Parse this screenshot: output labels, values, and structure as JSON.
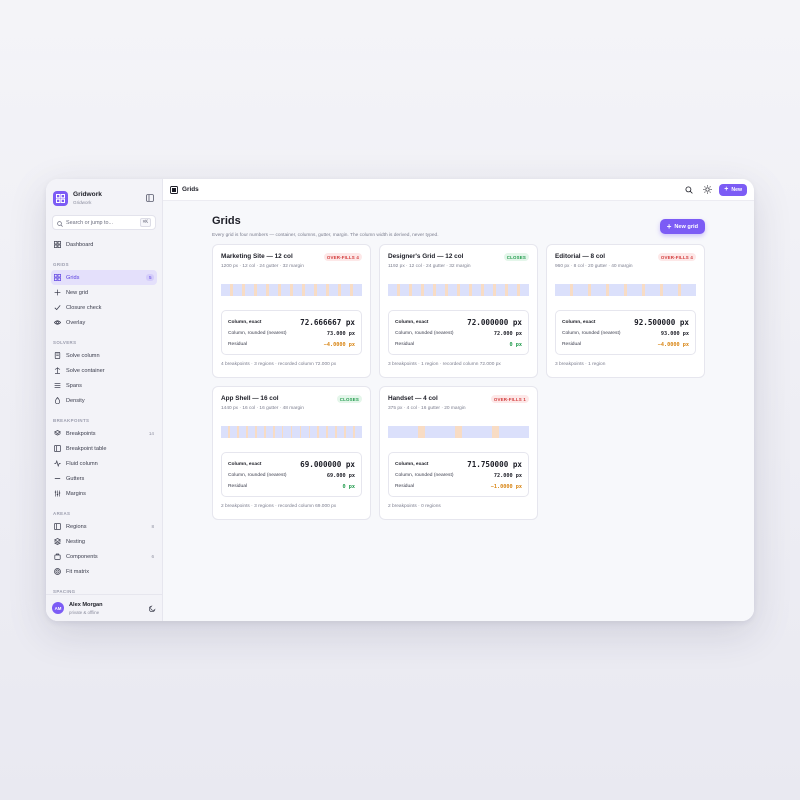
{
  "app": {
    "name": "Gridwork",
    "subtitle": "Gridwork"
  },
  "search": {
    "placeholder": "Search or jump to...",
    "shortcut": "⌘K"
  },
  "nav": {
    "top": [
      {
        "label": "Dashboard",
        "icon": "dashboard-icon"
      }
    ],
    "sections": [
      {
        "title": "GRIDS",
        "items": [
          {
            "label": "Grids",
            "count": "5",
            "active": true
          },
          {
            "label": "New grid"
          },
          {
            "label": "Closure check"
          },
          {
            "label": "Overlay"
          }
        ]
      },
      {
        "title": "SOLVERS",
        "items": [
          {
            "label": "Solve column"
          },
          {
            "label": "Solve container"
          },
          {
            "label": "Spans"
          },
          {
            "label": "Density"
          }
        ]
      },
      {
        "title": "BREAKPOINTS",
        "items": [
          {
            "label": "Breakpoints",
            "count": "14"
          },
          {
            "label": "Breakpoint table"
          },
          {
            "label": "Fluid column"
          },
          {
            "label": "Gutters"
          },
          {
            "label": "Margins"
          }
        ]
      },
      {
        "title": "AREAS",
        "items": [
          {
            "label": "Regions",
            "count": "8"
          },
          {
            "label": "Nesting"
          },
          {
            "label": "Components",
            "count": "6"
          },
          {
            "label": "Fit matrix"
          }
        ]
      },
      {
        "title": "SPACING",
        "items": []
      }
    ]
  },
  "user": {
    "initials": "AM",
    "name": "Alex Morgan",
    "status": "private & offline"
  },
  "topbar": {
    "title": "Grids",
    "new_label": "New"
  },
  "page": {
    "title": "Grids",
    "description": "Every grid is four numbers — container, columns, gutter, margin. The column width is derived, never typed.",
    "new_grid_label": "New grid"
  },
  "labels": {
    "exact": "Column, exact",
    "rounded": "Column, rounded (nearest)",
    "residual": "Residual"
  },
  "colors": {
    "accent": "#7c5cf5",
    "column": "#dbe0fb",
    "gutter": "#f8dcc4"
  },
  "cards": [
    {
      "title": "Marketing Site — 12 col",
      "meta": "1200 px · 12 col · 24 gutter · 32 margin",
      "badge": "OVER-FILLS 4",
      "status": "over",
      "columns": 12,
      "gutter_ratio": 0.33,
      "exact": "72.666667 px",
      "rounded": "73.000 px",
      "residual": "−4.0000 px",
      "residual_kind": "neg",
      "footer": "4 breakpoints · 3 regions · recorded column 72.000 px"
    },
    {
      "title": "Designer's Grid — 12 col",
      "meta": "1192 px · 12 col · 24 gutter · 32 margin",
      "badge": "CLOSES",
      "status": "close",
      "columns": 12,
      "gutter_ratio": 0.33,
      "exact": "72.000000 px",
      "rounded": "72.000 px",
      "residual": "0 px",
      "residual_kind": "zero",
      "footer": "3 breakpoints · 1 region · recorded column 72.000 px"
    },
    {
      "title": "Editorial — 8 col",
      "meta": "960 px · 8 col · 20 gutter · 40 margin",
      "badge": "OVER-FILLS 4",
      "status": "over",
      "columns": 8,
      "gutter_ratio": 0.22,
      "exact": "92.500000 px",
      "rounded": "93.000 px",
      "residual": "−4.0000 px",
      "residual_kind": "neg",
      "footer": "3 breakpoints · 1 region"
    },
    {
      "title": "App Shell — 16 col",
      "meta": "1440 px · 16 col · 16 gutter · 48 margin",
      "badge": "CLOSES",
      "status": "close",
      "columns": 16,
      "gutter_ratio": 0.23,
      "exact": "69.000000 px",
      "rounded": "69.000 px",
      "residual": "0 px",
      "residual_kind": "zero",
      "footer": "2 breakpoints · 3 regions · recorded column 69.000 px"
    },
    {
      "title": "Handset — 4 col",
      "meta": "375 px · 4 col · 16 gutter · 20 margin",
      "badge": "OVER-FILLS 1",
      "status": "over",
      "columns": 4,
      "gutter_ratio": 0.22,
      "exact": "71.750000 px",
      "rounded": "72.000 px",
      "residual": "−1.0000 px",
      "residual_kind": "neg",
      "footer": "2 breakpoints · 0 regions"
    }
  ]
}
